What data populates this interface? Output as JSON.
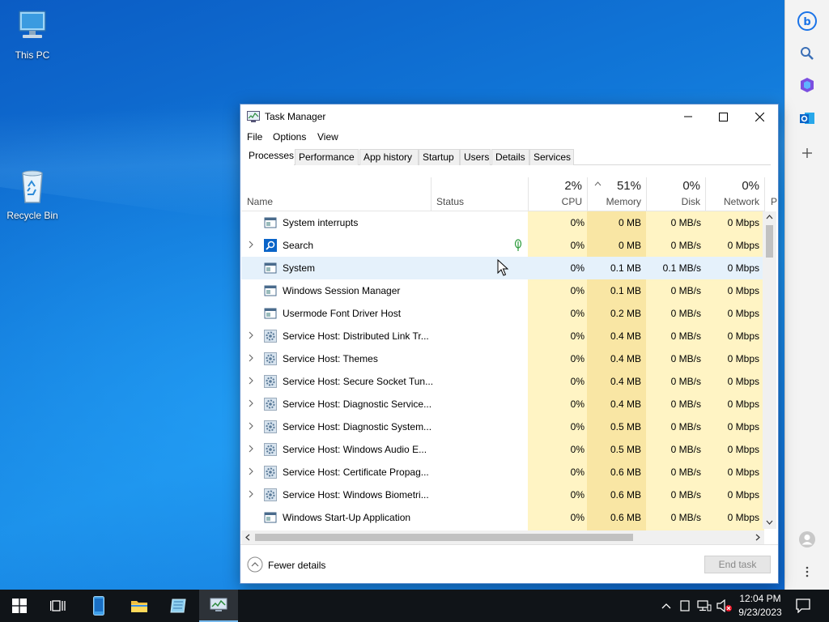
{
  "desktop": {
    "icons": [
      {
        "label": "This PC"
      },
      {
        "label": "Recycle Bin"
      }
    ]
  },
  "window": {
    "title": "Task Manager",
    "menu": [
      "File",
      "Options",
      "View"
    ],
    "tabs": [
      "Processes",
      "Performance",
      "App history",
      "Startup",
      "Users",
      "Details",
      "Services"
    ],
    "active_tab": "Processes"
  },
  "columns": {
    "name": "Name",
    "status": "Status",
    "cpu": {
      "pct": "2%",
      "label": "CPU"
    },
    "memory": {
      "pct": "51%",
      "label": "Memory"
    },
    "disk": {
      "pct": "0%",
      "label": "Disk"
    },
    "network": {
      "pct": "0%",
      "label": "Network"
    },
    "power_partial": "P"
  },
  "processes": [
    {
      "name": "System interrupts",
      "expandable": false,
      "icon": "window-icon",
      "cpu": "0%",
      "mem": "0 MB",
      "disk": "0 MB/s",
      "net": "0 Mbps"
    },
    {
      "name": "Search",
      "expandable": true,
      "icon": "search-icon",
      "status_icon": "leaf",
      "cpu": "0%",
      "mem": "0 MB",
      "disk": "0 MB/s",
      "net": "0 Mbps"
    },
    {
      "name": "System",
      "expandable": false,
      "icon": "window-icon",
      "cpu": "0%",
      "mem": "0.1 MB",
      "disk": "0.1 MB/s",
      "net": "0 Mbps"
    },
    {
      "name": "Windows Session Manager",
      "expandable": false,
      "icon": "window-icon",
      "cpu": "0%",
      "mem": "0.1 MB",
      "disk": "0 MB/s",
      "net": "0 Mbps"
    },
    {
      "name": "Usermode Font Driver Host",
      "expandable": false,
      "icon": "window-icon",
      "cpu": "0%",
      "mem": "0.2 MB",
      "disk": "0 MB/s",
      "net": "0 Mbps"
    },
    {
      "name": "Service Host: Distributed Link Tr...",
      "expandable": true,
      "icon": "gear-icon",
      "cpu": "0%",
      "mem": "0.4 MB",
      "disk": "0 MB/s",
      "net": "0 Mbps"
    },
    {
      "name": "Service Host: Themes",
      "expandable": true,
      "icon": "gear-icon",
      "cpu": "0%",
      "mem": "0.4 MB",
      "disk": "0 MB/s",
      "net": "0 Mbps"
    },
    {
      "name": "Service Host: Secure Socket Tun...",
      "expandable": true,
      "icon": "gear-icon",
      "cpu": "0%",
      "mem": "0.4 MB",
      "disk": "0 MB/s",
      "net": "0 Mbps"
    },
    {
      "name": "Service Host: Diagnostic Service...",
      "expandable": true,
      "icon": "gear-icon",
      "cpu": "0%",
      "mem": "0.4 MB",
      "disk": "0 MB/s",
      "net": "0 Mbps"
    },
    {
      "name": "Service Host: Diagnostic System...",
      "expandable": true,
      "icon": "gear-icon",
      "cpu": "0%",
      "mem": "0.5 MB",
      "disk": "0 MB/s",
      "net": "0 Mbps"
    },
    {
      "name": "Service Host: Windows Audio E...",
      "expandable": true,
      "icon": "gear-icon",
      "cpu": "0%",
      "mem": "0.5 MB",
      "disk": "0 MB/s",
      "net": "0 Mbps"
    },
    {
      "name": "Service Host: Certificate Propag...",
      "expandable": true,
      "icon": "gear-icon",
      "cpu": "0%",
      "mem": "0.6 MB",
      "disk": "0 MB/s",
      "net": "0 Mbps"
    },
    {
      "name": "Service Host: Windows Biometri...",
      "expandable": true,
      "icon": "gear-icon",
      "cpu": "0%",
      "mem": "0.6 MB",
      "disk": "0 MB/s",
      "net": "0 Mbps"
    },
    {
      "name": "Windows Start-Up Application",
      "expandable": false,
      "icon": "window-icon",
      "cpu": "0%",
      "mem": "0.6 MB",
      "disk": "0 MB/s",
      "net": "0 Mbps"
    }
  ],
  "footer": {
    "fewer_details": "Fewer details",
    "end_task": "End task"
  },
  "taskbar": {
    "time": "12:04 PM",
    "date": "9/23/2023"
  },
  "colors": {
    "accent": "#0078d7",
    "heat_light": "#fff4c4",
    "heat_mid": "#fbe9a6",
    "heat_strong": "#f9e29a"
  }
}
